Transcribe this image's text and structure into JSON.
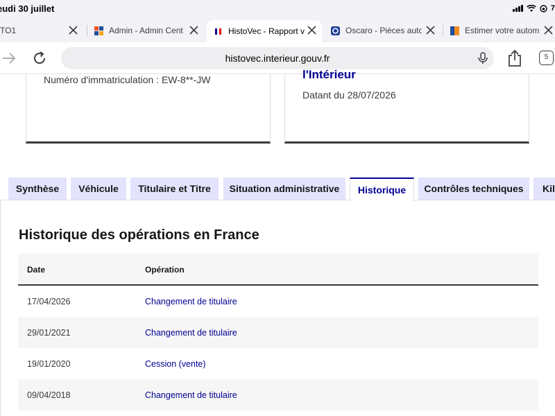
{
  "status": {
    "time": "eudi 30 juillet",
    "battery": "7"
  },
  "browser": {
    "tabs": [
      {
        "title": "TO1",
        "active": false
      },
      {
        "title": "Admin - Admin Cent",
        "active": false
      },
      {
        "title": "HistoVec - Rapport v",
        "active": true
      },
      {
        "title": "Oscaro - Pièces auto",
        "active": false
      },
      {
        "title": "Estimer votre autom",
        "active": false
      }
    ],
    "url": "histovec.interieur.gouv.fr",
    "tab_count": "5"
  },
  "cards": {
    "plate": "Numéro d'immatriculation : EW-8**-JW",
    "heading": "l'Intérieur",
    "date": "Datant du 28/07/2026"
  },
  "page_tabs": [
    "Synthèse",
    "Véhicule",
    "Titulaire et Titre",
    "Situation administrative",
    "Historique",
    "Contrôles techniques",
    "Kilo"
  ],
  "history": {
    "title": "Historique des opérations en France",
    "columns": [
      "Date",
      "Opération"
    ],
    "rows": [
      {
        "date": "17/04/2026",
        "operation": "Changement de titulaire"
      },
      {
        "date": "29/01/2021",
        "operation": "Changement de titulaire"
      },
      {
        "date": "19/01/2020",
        "operation": "Cession (vente)"
      },
      {
        "date": "09/04/2018",
        "operation": "Changement de titulaire"
      }
    ]
  },
  "colors": {
    "accent": "#000091",
    "tab_bg": "#e3e3fd"
  }
}
